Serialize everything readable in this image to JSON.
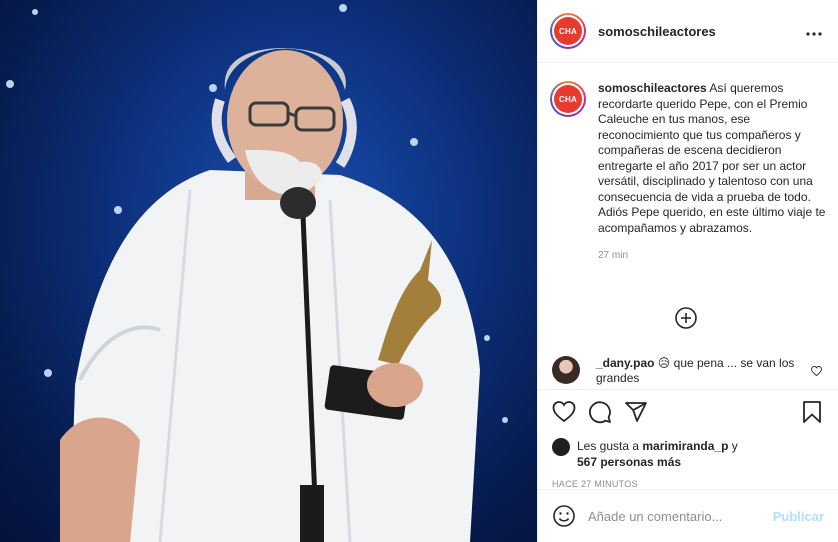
{
  "post": {
    "account": "somoschileactores",
    "logo_text": "CHA",
    "more_label": "•••"
  },
  "caption": {
    "user": "somoschileactores",
    "text": " Así queremos recordarte querido Pepe, con el Premio Caleuche en tus manos, ese reconocimiento que tus compañeros y compañeras de escena decidieron entregarte el año 2017 por ser un actor versátil, disciplinado y talentoso con una consecuencia de vida a prueba de todo. Adiós Pepe querido, en este último viaje te acompañamos y abrazamos.",
    "time": "27 min"
  },
  "comment": {
    "user": "_dany.pao",
    "text": " 😥 que pena ... se van los grandes"
  },
  "likes": {
    "prefix": "Les gusta a ",
    "user": "marimiranda_p",
    "middle": " y",
    "count": "567 personas más"
  },
  "timestamp": "HACE 27 MINUTOS",
  "composer": {
    "placeholder": "Añade un comentario...",
    "publish_label": "Publicar"
  },
  "icons": {
    "more": "more-icon",
    "load_more": "plus-circle-icon",
    "like": "heart-icon",
    "comment": "comment-icon",
    "share": "share-icon",
    "save": "bookmark-icon",
    "emoji": "smiley-icon"
  },
  "colors": {
    "brand_logo": "#e63b2e",
    "publish_disabled": "#b2dffc",
    "secondary_text": "#8e8e8e",
    "stage_background": "#0c2f7a"
  }
}
